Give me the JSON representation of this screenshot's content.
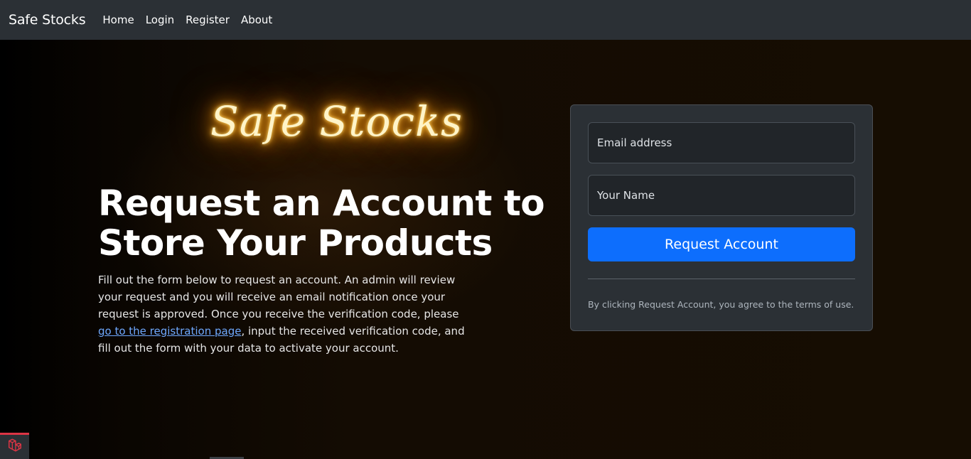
{
  "navbar": {
    "brand": "Safe Stocks",
    "links": [
      "Home",
      "Login",
      "Register",
      "About"
    ]
  },
  "hero": {
    "neon_logo": "Safe Stocks",
    "headline": "Request an Account to Store Your Products",
    "description_before_link": "Fill out the form below to request an account. An admin will review your request and you will receive an email notification once your request is approved. Once you receive the verification code, please ",
    "description_link": "go to the registration page",
    "description_after_link": ", input the received verification code, and fill out the form with your data to activate your account."
  },
  "form": {
    "email_placeholder": "Email address",
    "name_placeholder": "Your Name",
    "submit_label": "Request Account",
    "terms": "By clicking Request Account, you agree to the terms of use."
  },
  "colors": {
    "navbar": "#2b3035",
    "primary": "#0d6efd",
    "link": "#6ea8fe",
    "neon": "#ff9a0a",
    "debug_accent": "#dc3545"
  },
  "icons": {
    "debug_badge": "laravel-icon"
  }
}
